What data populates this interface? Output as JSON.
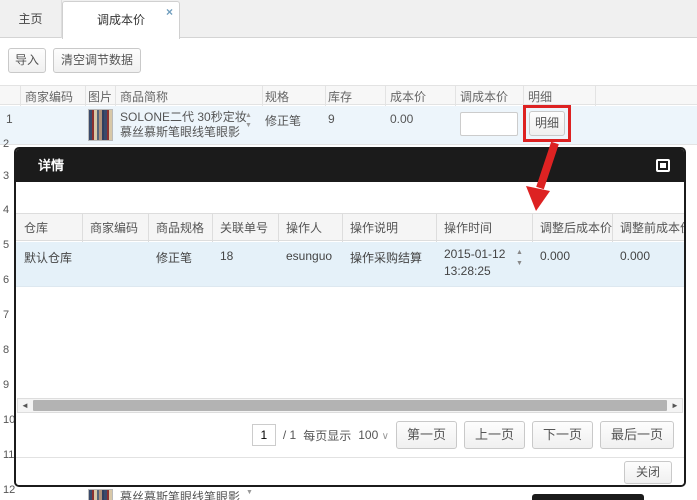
{
  "tabs": {
    "home_label": "主页",
    "active_label": "调成本价",
    "close_icon": "×"
  },
  "toolbar": {
    "import_label": "导入",
    "clear_label": "清空调节数据"
  },
  "icons": {
    "sort_up": "▲",
    "sort_down": "▼",
    "scroll_left": "◄",
    "scroll_right": "►",
    "caret_down": "∨"
  },
  "colors": {
    "annotation_red": "#dd2222",
    "modal_titlebar": "#1b1b1b",
    "selected_row": "#edf5fb",
    "modal_row": "#e5f1f9"
  },
  "main_table": {
    "headers": [
      "商家编码",
      "图片",
      "商品简称",
      "规格",
      "库存",
      "成本价",
      "调成本价",
      "明细"
    ],
    "row": {
      "index": "1",
      "name_line1": "SOLONE二代 30秒定妆",
      "name_line2": "慕丝慕斯笔眼线笔眼影",
      "spec": "修正笔",
      "stock": "9",
      "cost": "0.00",
      "adjust_value": "",
      "detail_label": "明细"
    },
    "row_numbers": [
      "2",
      "3",
      "4",
      "5",
      "6",
      "7",
      "8",
      "9",
      "10",
      "11",
      "12"
    ],
    "partial_row_name": "慕丝慕斯笔眼线笔眼影"
  },
  "modal": {
    "title": "详情",
    "table": {
      "headers": [
        "仓库",
        "商家编码",
        "商品规格",
        "关联单号",
        "操作人",
        "操作说明",
        "操作时间",
        "调整后成本价",
        "调整前成本价"
      ],
      "row": {
        "warehouse": "默认仓库",
        "merchant_code": "",
        "spec": "修正笔",
        "related_no": "18",
        "operator": "esunguo",
        "description": "操作采购结算",
        "time_line1": "2015-01-12",
        "time_line2": "13:28:25",
        "cost_after": "0.000",
        "cost_before": "0.000"
      }
    },
    "pagination": {
      "page_value": "1",
      "total_label": "/ 1",
      "per_page_label": "每页显示",
      "per_page_value": "100",
      "first_label": "第一页",
      "prev_label": "上一页",
      "next_label": "下一页",
      "last_label": "最后一页"
    },
    "close_label": "关闭"
  }
}
